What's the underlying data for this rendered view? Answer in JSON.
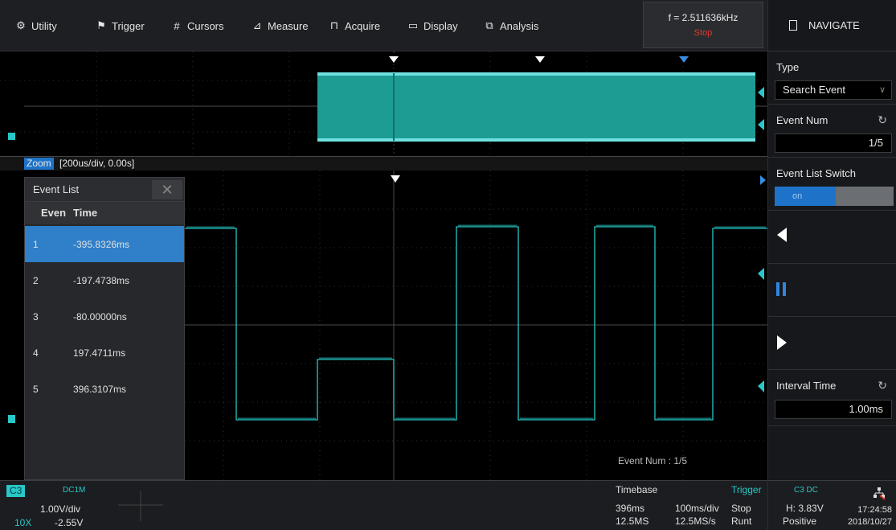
{
  "menu": [
    {
      "label": "Utility",
      "icon": "gear-icon",
      "glyph": "⚙"
    },
    {
      "label": "Trigger",
      "icon": "flag-icon",
      "glyph": "⚑"
    },
    {
      "label": "Cursors",
      "icon": "cursors-icon",
      "glyph": "#"
    },
    {
      "label": "Measure",
      "icon": "measure-icon",
      "glyph": "⊿"
    },
    {
      "label": "Acquire",
      "icon": "acquire-icon",
      "glyph": "⊓"
    },
    {
      "label": "Display",
      "icon": "display-icon",
      "glyph": "▭"
    },
    {
      "label": "Analysis",
      "icon": "analysis-icon",
      "glyph": "⧉"
    }
  ],
  "status": {
    "frequency": "f = 2.511636kHz",
    "run_state": "Stop"
  },
  "panel": {
    "title": "NAVIGATE",
    "type_label": "Type",
    "type_value": "Search Event",
    "event_num_label": "Event Num",
    "event_num_value": "1/5",
    "event_list_switch_label": "Event List Switch",
    "event_list_switch_value": "on",
    "interval_time_label": "Interval Time",
    "interval_time_value": "1.00ms"
  },
  "zoom": {
    "tag": "Zoom",
    "params": "[200us/div, 0.00s]"
  },
  "event_list": {
    "title": "Event List",
    "col_index": "Even",
    "col_time": "Time",
    "rows": [
      {
        "index": "1",
        "time": "-395.8326ms",
        "selected": true
      },
      {
        "index": "2",
        "time": "-197.4738ms",
        "selected": false
      },
      {
        "index": "3",
        "time": "-80.00000ns",
        "selected": false
      },
      {
        "index": "4",
        "time": "197.4711ms",
        "selected": false
      },
      {
        "index": "5",
        "time": "396.3107ms",
        "selected": false
      }
    ]
  },
  "event_num_overlay": "Event Num : 1/5",
  "channel": {
    "name": "C3",
    "coupling": "DC1M",
    "scale": "1.00V/div",
    "offset": "-2.55V",
    "probe": "10X"
  },
  "timebase": {
    "label": "Timebase",
    "delay": "396ms",
    "scale": "100ms/div",
    "sample_points": "12.5MS",
    "sample_rate": "12.5MS/s"
  },
  "trigger": {
    "label": "Trigger",
    "state": "Stop",
    "type": "Runt",
    "source": "C3 DC",
    "level": "H: 3.83V",
    "slope": "Positive"
  },
  "clock": {
    "time": "17:24:58",
    "date": "2018/10/27"
  },
  "colors": {
    "trace": "#28c8c8",
    "overview_fill": "#1d9c94",
    "accent": "#1e73c9",
    "stop": "#e03a2c"
  }
}
